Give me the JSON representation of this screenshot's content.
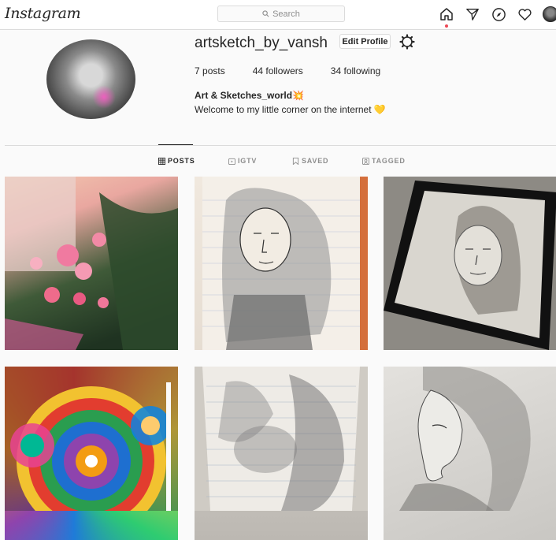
{
  "app": {
    "logo": "Instagram"
  },
  "search": {
    "placeholder": "Search"
  },
  "profile": {
    "username": "artsketch_by_vansh",
    "edit_label": "Edit Profile",
    "stats": [
      {
        "count": "7",
        "label": "posts"
      },
      {
        "count": "44",
        "label": "followers"
      },
      {
        "count": "34",
        "label": "following"
      }
    ],
    "bio_name": "Art & Sketches_world💥",
    "bio_text": "Welcome to my little corner on the internet 💛"
  },
  "tabs": [
    {
      "label": "POSTS",
      "icon": "grid-icon",
      "active": true
    },
    {
      "label": "IGTV",
      "icon": "igtv-icon"
    },
    {
      "label": "SAVED",
      "icon": "bookmark-icon"
    },
    {
      "label": "TAGGED",
      "icon": "tagged-icon"
    }
  ],
  "posts": [
    "photo-pink-flowers",
    "sketch-woman-curly-hair-lined-paper",
    "sketch-woman-portrait-framed",
    "colorful-mandala-art",
    "sketch-zentangle-lined-paper",
    "sketch-woman-profile"
  ],
  "colors": {
    "accent": "#ed4956",
    "text": "#262626",
    "muted": "#8e8e8e",
    "border": "#dbdbdb"
  }
}
